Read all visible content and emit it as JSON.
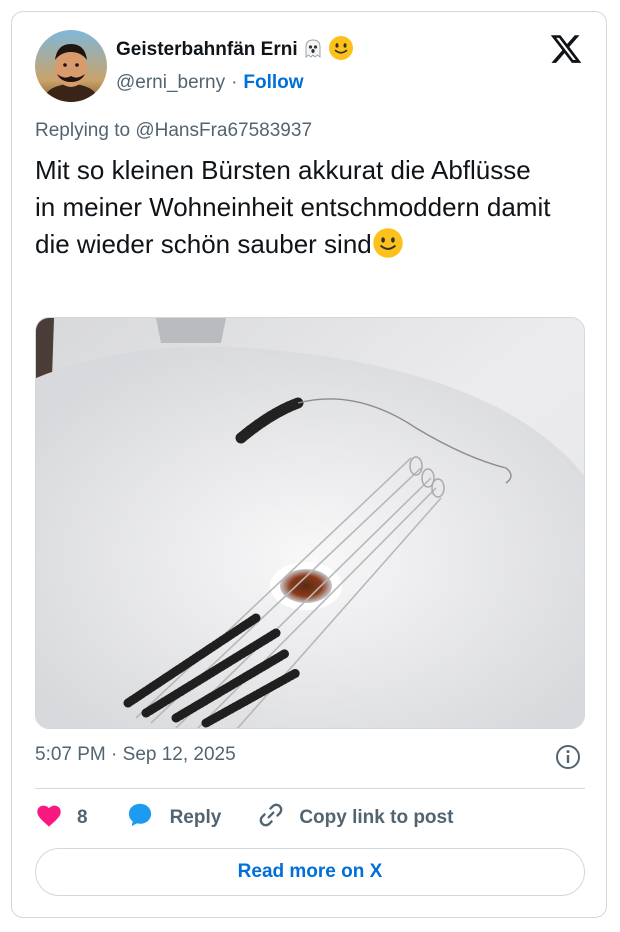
{
  "author": {
    "display_name": "Geisterbahnfän Erni",
    "handle": "@erni_berny",
    "separator": "·",
    "follow_label": "Follow",
    "name_emojis": [
      "ghost-emoji",
      "slightly-smiling-face-emoji"
    ]
  },
  "tweet": {
    "replying_to": "Replying to @HansFra67583937",
    "text": "Mit so kleinen Bürsten akkurat die Abflüsse in meiner Wohneinheit entschmoddern damit die wieder schön sauber sind",
    "text_emoji": "slightly-smiling-face-emoji",
    "timestamp": "5:07 PM · Sep 12, 2025"
  },
  "actions": {
    "like_count": "8",
    "reply_label": "Reply",
    "copy_label": "Copy link to post",
    "read_more_label": "Read more on X"
  },
  "icons": {
    "logo": "x-logo-icon",
    "info": "info-icon",
    "like": "heart-icon",
    "reply": "speech-bubble-icon",
    "copy": "link-icon"
  },
  "colors": {
    "accent": "#006fd6",
    "like": "#f91880",
    "secondary_text": "#536471",
    "border": "#cfd9de",
    "reply_icon": "#1d9bf0"
  }
}
